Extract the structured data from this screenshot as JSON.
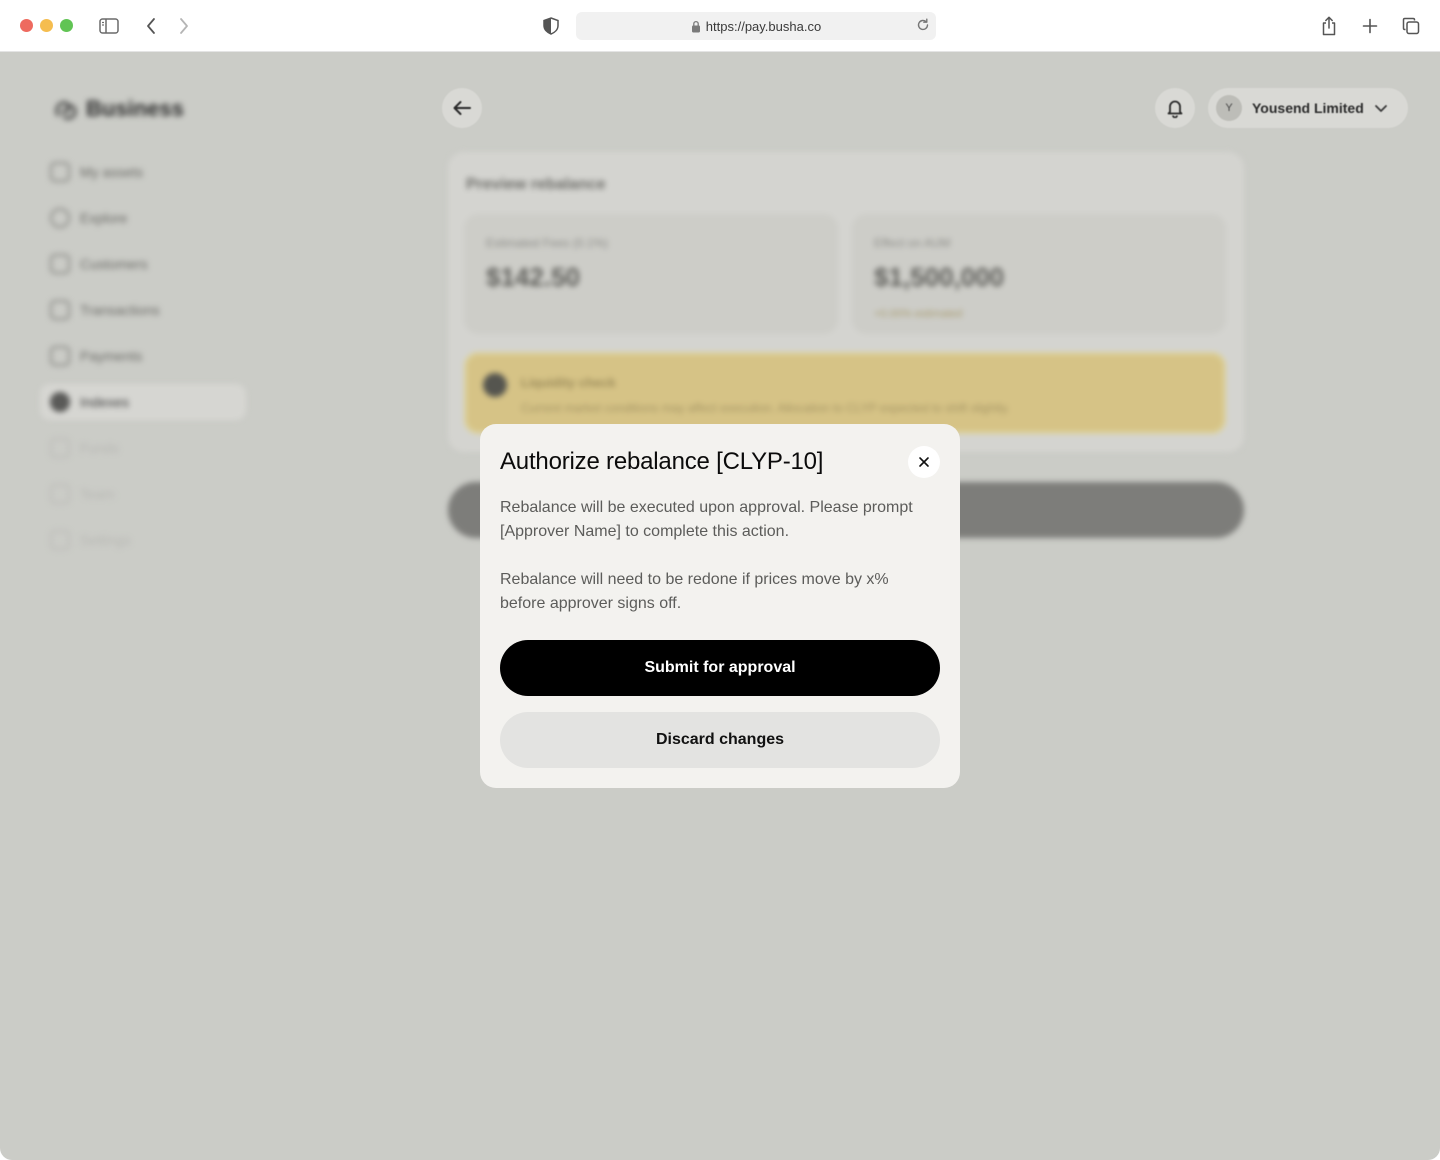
{
  "browser": {
    "url": "https://pay.busha.co"
  },
  "app": {
    "logo_text": "Business",
    "sidebar": {
      "items": [
        {
          "label": "My assets",
          "icon": "wallet-icon"
        },
        {
          "label": "Explore",
          "icon": "compass-icon"
        },
        {
          "label": "Customers",
          "icon": "users-icon"
        },
        {
          "label": "Transactions",
          "icon": "list-icon"
        },
        {
          "label": "Payments",
          "icon": "card-icon"
        },
        {
          "label": "Indexes",
          "icon": "index-icon"
        },
        {
          "label": "Funds",
          "icon": "fund-icon"
        },
        {
          "label": "Team",
          "icon": "team-icon"
        },
        {
          "label": "Settings",
          "icon": "settings-icon"
        }
      ]
    },
    "header": {
      "account_initial": "Y",
      "account_name": "Yousend Limited"
    },
    "preview": {
      "title": "Preview rebalance",
      "fees_label": "Estimated Fees (0.1%)",
      "fees_value": "$142.50",
      "aum_label": "Effect on AUM",
      "aum_value": "$1,500,000",
      "aum_sub": "+0.00% estimated",
      "warning_title": "Liquidity check",
      "warning_text": "Current market conditions may affect execution. Allocation to CLYP expected to shift slightly."
    }
  },
  "modal": {
    "title": "Authorize rebalance [CLYP-10]",
    "paragraph_1": "Rebalance will be executed upon approval. Please prompt [Approver Name] to complete this action.",
    "paragraph_2": "Rebalance will need to be redone if prices move by x% before approver signs off.",
    "primary_label": "Submit for approval",
    "secondary_label": "Discard changes"
  }
}
